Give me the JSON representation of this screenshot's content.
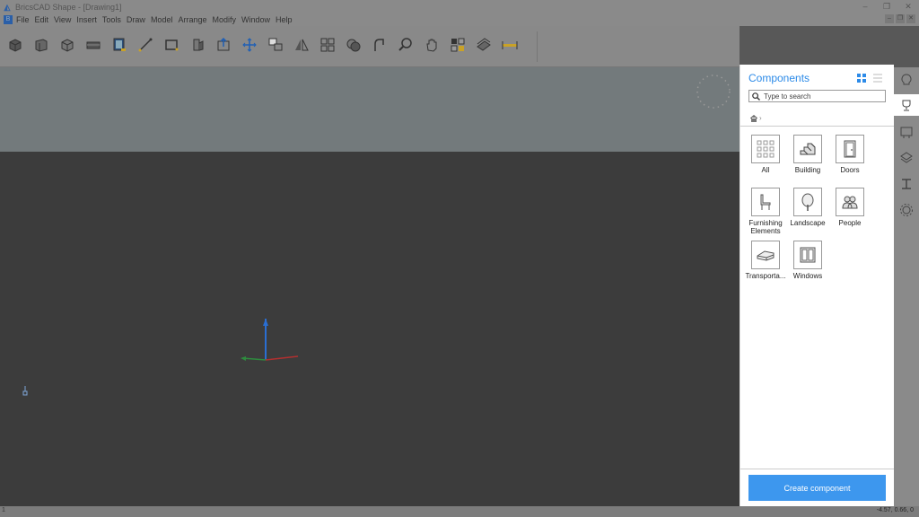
{
  "window": {
    "title": "BricsCAD Shape - [Drawing1]",
    "controls": [
      "–",
      "❐",
      "✕"
    ]
  },
  "menu": {
    "items": [
      "File",
      "Edit",
      "View",
      "Insert",
      "Tools",
      "Draw",
      "Model",
      "Arrange",
      "Modify",
      "Window",
      "Help"
    ],
    "mdi_controls": [
      "–",
      "❐",
      "✕"
    ]
  },
  "toolbar": {
    "tools": [
      "box-icon",
      "wall-icon",
      "cube-icon",
      "slab-icon",
      "window-icon",
      "line-icon",
      "rectangle-icon",
      "extrude-icon",
      "push-pull-icon",
      "move-icon",
      "copy-icon",
      "mirror-icon",
      "array-icon",
      "union-icon",
      "fillet-icon",
      "zoom-icon",
      "pan-icon",
      "layers-icon",
      "materials-icon",
      "dimension-icon"
    ]
  },
  "components": {
    "title": "Components",
    "search_placeholder": "Type to search",
    "categories": [
      {
        "label": "All",
        "icon": "grid-icon"
      },
      {
        "label": "Building",
        "icon": "stairs-icon"
      },
      {
        "label": "Doors",
        "icon": "door-icon"
      },
      {
        "label": "Furnishing Elements",
        "icon": "chair-icon"
      },
      {
        "label": "Landscape",
        "icon": "tree-icon"
      },
      {
        "label": "People",
        "icon": "people-icon"
      },
      {
        "label": "Transporta...",
        "icon": "car-icon"
      },
      {
        "label": "Windows",
        "icon": "window-pane-icon"
      }
    ],
    "create_label": "Create component"
  },
  "status": {
    "left": "1",
    "coords": "-4.57, 0.66, 0"
  },
  "colors": {
    "accent": "#3d97ee",
    "title_blue": "#2d8be8"
  }
}
